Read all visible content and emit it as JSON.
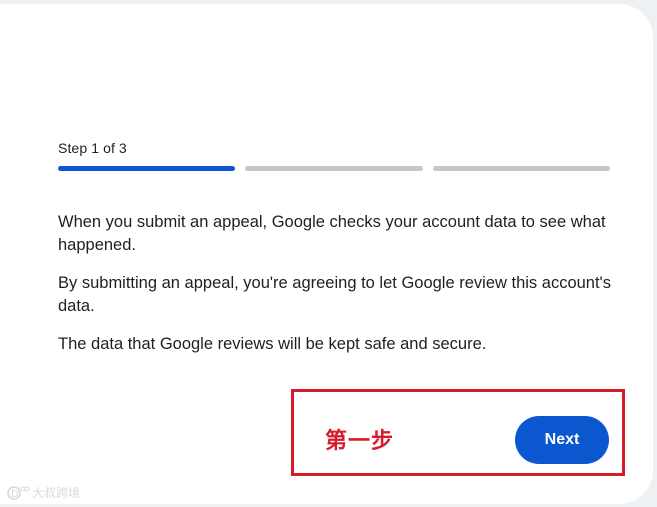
{
  "step": {
    "label": "Step 1 of 3",
    "current": 1,
    "total": 3
  },
  "body": {
    "paragraphs": [
      "When you submit an appeal, Google checks your account data to see what happened.",
      "By submitting an appeal, you're agreeing to let Google review this account's data.",
      "The data that Google reviews will be kept safe and secure."
    ]
  },
  "actions": {
    "next_label": "Next"
  },
  "annotation": {
    "text": "第一步"
  },
  "watermark": {
    "text": "大叔跨境",
    "logo_text": "D",
    "icon": "watermark-logo-icon"
  },
  "colors": {
    "accent": "#0b57d0",
    "progress_inactive": "#c4c7c5",
    "annotation_red": "#d81b2a",
    "text": "#1f1f1f"
  }
}
